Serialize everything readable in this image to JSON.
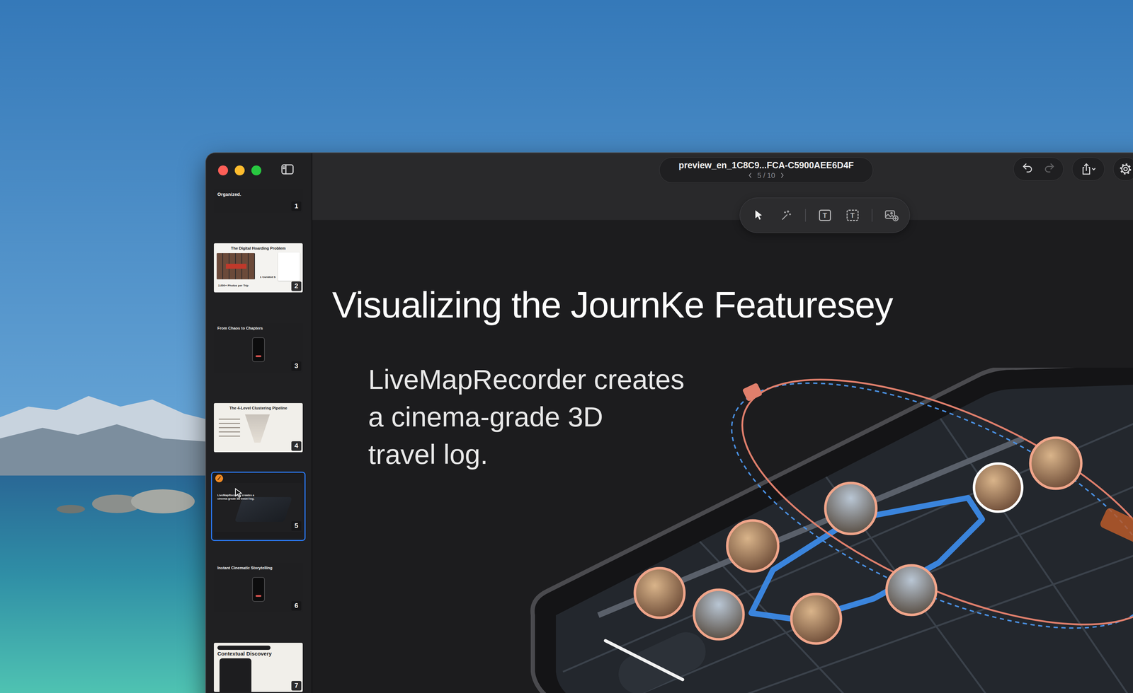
{
  "window": {
    "title": "preview_en_1C8C9...FCA-C5900AEE6D4F",
    "page": "5 / 10"
  },
  "history": [
    {
      "kind": "undo",
      "disabled": false
    },
    {
      "kind": "redo",
      "disabled": true
    }
  ],
  "tools": [
    {
      "kind": "select",
      "label": "",
      "selected": true
    },
    {
      "kind": "magic",
      "label": "",
      "selected": false
    },
    {
      "kind": "text",
      "label": "T",
      "selected": false
    },
    {
      "kind": "text-box",
      "label": "T",
      "selected": false
    },
    {
      "kind": "image",
      "label": "",
      "selected": false
    }
  ],
  "slides": [
    {
      "number": "1",
      "kind": "dark",
      "title": "Organized.",
      "captions": [],
      "selected": false,
      "edited": false
    },
    {
      "number": "2",
      "kind": "split",
      "title": "The Digital Hoarding Problem",
      "captions": [
        "2,000+ Photos per Trip",
        "1 Curated S"
      ],
      "selected": false,
      "edited": false
    },
    {
      "number": "3",
      "kind": "dark",
      "title": "From Chaos to Chapters",
      "captions": [],
      "selected": false,
      "edited": false
    },
    {
      "number": "4",
      "kind": "light",
      "title": "The 4-Level Clustering Pipeline",
      "captions": [],
      "selected": false,
      "edited": false
    },
    {
      "number": "5",
      "kind": "dark",
      "title": "LiveMapRecorder creates a cinema-grade 3D travel log.",
      "captions": [],
      "selected": true,
      "edited": true
    },
    {
      "number": "6",
      "kind": "dark",
      "title": "Instant Cinematic Storytelling",
      "captions": [],
      "selected": false,
      "edited": false
    },
    {
      "number": "7",
      "kind": "light",
      "title": "Contextual Discovery",
      "captions": [],
      "selected": false,
      "edited": false
    }
  ],
  "slide": {
    "title": "Visualizing the JournKe Featuresey",
    "lines": [
      "LiveMapRecorder creates",
      "a cinema-grade 3D",
      "travel log."
    ]
  }
}
